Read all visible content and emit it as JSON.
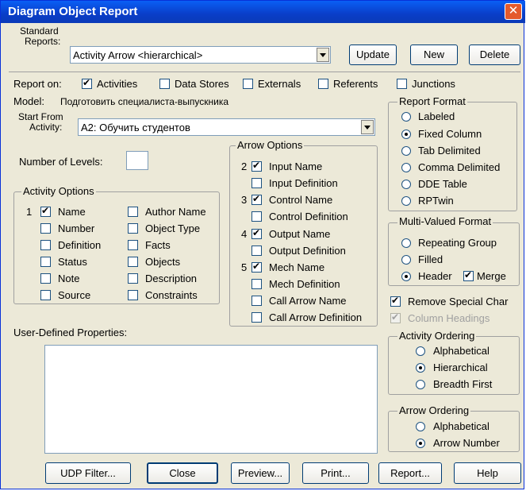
{
  "window": {
    "title": "Diagram Object Report"
  },
  "standard_reports": {
    "label_line1": "Standard",
    "label_line2": "Reports:",
    "value": "Activity Arrow <hierarchical>",
    "update_label": "Update",
    "new_label": "New",
    "delete_label": "Delete"
  },
  "report_on": {
    "label": "Report on:",
    "items": [
      {
        "label": "Activities",
        "checked": true
      },
      {
        "label": "Data Stores",
        "checked": false
      },
      {
        "label": "Externals",
        "checked": false
      },
      {
        "label": "Referents",
        "checked": false
      },
      {
        "label": "Junctions",
        "checked": false
      }
    ]
  },
  "model": {
    "label": "Model:",
    "value": "Подготовить специалиста-выпускника"
  },
  "start_from": {
    "label_line1": "Start From",
    "label_line2": "Activity:",
    "value": "A2: Обучить студентов"
  },
  "levels": {
    "label": "Number of Levels:",
    "value": ""
  },
  "activity_options": {
    "title": "Activity Options",
    "col1": [
      {
        "order": "1",
        "label": "Name",
        "checked": true
      },
      {
        "order": "",
        "label": "Number",
        "checked": false
      },
      {
        "order": "",
        "label": "Definition",
        "checked": false
      },
      {
        "order": "",
        "label": "Status",
        "checked": false
      },
      {
        "order": "",
        "label": "Note",
        "checked": false
      },
      {
        "order": "",
        "label": "Source",
        "checked": false
      }
    ],
    "col2": [
      {
        "label": "Author Name",
        "checked": false
      },
      {
        "label": "Object Type",
        "checked": false
      },
      {
        "label": "Facts",
        "checked": false
      },
      {
        "label": "Objects",
        "checked": false
      },
      {
        "label": "Description",
        "checked": false
      },
      {
        "label": "Constraints",
        "checked": false
      }
    ]
  },
  "arrow_options": {
    "title": "Arrow Options",
    "items": [
      {
        "order": "2",
        "label": "Input Name",
        "checked": true
      },
      {
        "order": "",
        "label": "Input Definition",
        "checked": false
      },
      {
        "order": "3",
        "label": "Control Name",
        "checked": true
      },
      {
        "order": "",
        "label": "Control Definition",
        "checked": false
      },
      {
        "order": "4",
        "label": "Output Name",
        "checked": true
      },
      {
        "order": "",
        "label": "Output Definition",
        "checked": false
      },
      {
        "order": "5",
        "label": "Mech Name",
        "checked": true
      },
      {
        "order": "",
        "label": "Mech Definition",
        "checked": false
      },
      {
        "order": "",
        "label": "Call Arrow Name",
        "checked": false
      },
      {
        "order": "",
        "label": "Call Arrow Definition",
        "checked": false
      }
    ]
  },
  "report_format": {
    "title": "Report Format",
    "items": [
      {
        "label": "Labeled",
        "checked": false
      },
      {
        "label": "Fixed Column",
        "checked": true
      },
      {
        "label": "Tab Delimited",
        "checked": false
      },
      {
        "label": "Comma Delimited",
        "checked": false
      },
      {
        "label": "DDE Table",
        "checked": false
      },
      {
        "label": "RPTwin",
        "checked": false
      }
    ]
  },
  "multi_valued": {
    "title": "Multi-Valued Format",
    "items": [
      {
        "label": "Repeating Group",
        "checked": false
      },
      {
        "label": "Filled",
        "checked": false
      },
      {
        "label": "Header",
        "checked": true
      }
    ],
    "merge_label": "Merge",
    "merge_checked": true
  },
  "remove_special": {
    "label": "Remove Special Char",
    "checked": true
  },
  "column_headings": {
    "label": "Column Headings",
    "checked": true,
    "disabled": true
  },
  "activity_ordering": {
    "title": "Activity Ordering",
    "items": [
      {
        "label": "Alphabetical",
        "checked": false
      },
      {
        "label": "Hierarchical",
        "checked": true
      },
      {
        "label": "Breadth First",
        "checked": false
      }
    ]
  },
  "arrow_ordering": {
    "title": "Arrow Ordering",
    "items": [
      {
        "label": "Alphabetical",
        "checked": false
      },
      {
        "label": "Arrow Number",
        "checked": true
      }
    ]
  },
  "udp": {
    "label": "User-Defined Properties:"
  },
  "bottom_buttons": {
    "udp_filter": "UDP Filter...",
    "close": "Close",
    "preview": "Preview...",
    "print": "Print...",
    "report": "Report...",
    "help": "Help"
  }
}
